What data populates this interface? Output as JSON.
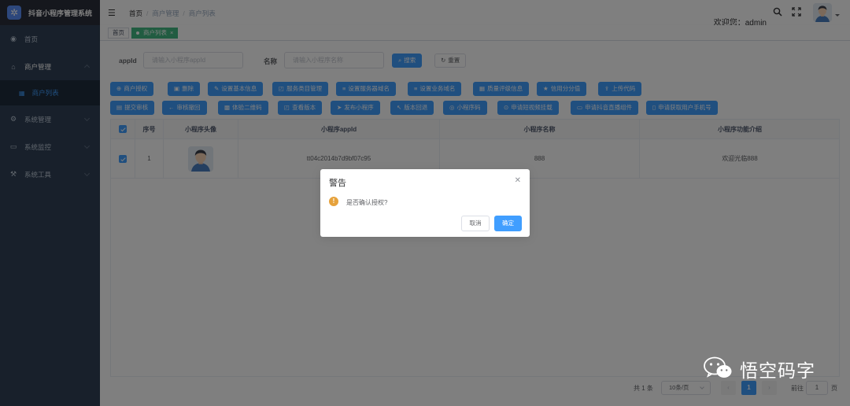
{
  "app": {
    "title": "抖音小程序管理系统"
  },
  "sidebar": {
    "items": [
      {
        "label": "首页",
        "icon": "dashboard-icon"
      },
      {
        "label": "商户管理",
        "icon": "shop-icon",
        "expanded": true
      },
      {
        "label": "商户列表",
        "icon": "grid-icon",
        "active": true
      },
      {
        "label": "系统管理",
        "icon": "gear-icon"
      },
      {
        "label": "系统监控",
        "icon": "monitor-icon"
      },
      {
        "label": "系统工具",
        "icon": "tool-icon"
      }
    ]
  },
  "header": {
    "breadcrumb": [
      "首页",
      "商户管理",
      "商户列表"
    ],
    "welcome": "欢迎您：admin"
  },
  "tags": {
    "home": "首页",
    "current": "商户列表"
  },
  "search": {
    "appid_label": "appId",
    "appid_placeholder": "请输入小程序appId",
    "name_label": "名称",
    "name_placeholder": "请输入小程序名称",
    "search_button": "搜索",
    "reset_button": "重置"
  },
  "toolbar": {
    "row1": [
      "商户授权",
      "删除",
      "设置基本信息",
      "服务类目管理",
      "设置服务器域名",
      "设置业务域名",
      "质量评级信息",
      "信用分分值",
      "上传代码"
    ],
    "row2": [
      "提交审核",
      "审核撤回",
      "体验二维码",
      "查看版本",
      "发布小程序",
      "版本回退",
      "小程序码",
      "申请短视频挂载",
      "申请抖音直播组件",
      "申请获取用户手机号"
    ]
  },
  "table": {
    "columns": [
      "序号",
      "小程序头像",
      "小程序appId",
      "小程序名称",
      "小程序功能介绍"
    ],
    "rows": [
      {
        "index": "1",
        "appid": "tt04c2014b7d9bf07c95",
        "name": "888",
        "intro": "欢迎光临888"
      }
    ]
  },
  "pagination": {
    "total": "共 1 条",
    "page_size": "10条/页",
    "current_page": "1",
    "goto_label": "前往",
    "goto_value": "1",
    "page_unit": "页"
  },
  "dialog": {
    "title": "警告",
    "message": "是否确认授权?",
    "cancel": "取消",
    "confirm": "确定"
  },
  "watermark": {
    "text": "悟空码字"
  },
  "colors": {
    "primary": "#409eff",
    "sidebar": "#304156",
    "warning": "#e6a23c",
    "tag_active": "#42b983"
  }
}
